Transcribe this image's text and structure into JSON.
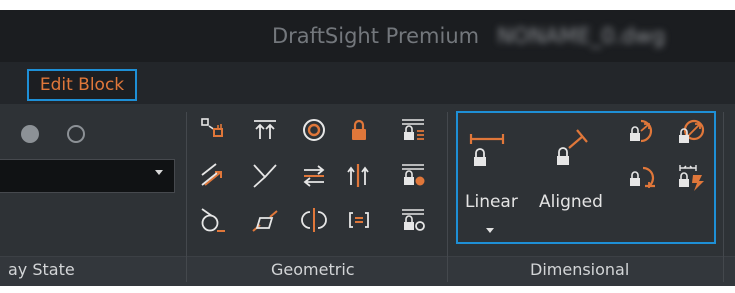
{
  "window": {
    "app_title": "DraftSight Premium",
    "file_name": "NONAME_0.dwg"
  },
  "tabs": {
    "active": "Edit Block"
  },
  "panels": {
    "display_state": {
      "label": "ay State"
    },
    "geometric": {
      "label": "Geometric"
    },
    "dimensional": {
      "label": "Dimensional",
      "linear_label": "Linear",
      "aligned_label": "Aligned"
    }
  },
  "colors": {
    "accent_orange": "#e0773a",
    "highlight_blue": "#1e8fd6",
    "icon_white": "#e6e6e6"
  },
  "icons": {
    "geometric": [
      "fix-constraint-icon",
      "horizontal-constraint-icon",
      "concentric-constraint-icon",
      "lock-icon",
      "show-constraints-icon",
      "parallel-constraint-icon",
      "perpendicular-constraint-icon",
      "equal-constraint-icon",
      "vertical-constraint-icon",
      "hide-constraint-icon",
      "tangent-constraint-icon",
      "collinear-constraint-icon",
      "symmetric-constraint-icon",
      "coincident-constraint-icon",
      "constraint-settings-icon"
    ],
    "dimensional": [
      "linear-dimension-icon",
      "aligned-dimension-icon",
      "radius-dimension-icon",
      "diameter-dimension-icon",
      "angular-dimension-icon",
      "convert-dimension-icon"
    ]
  }
}
